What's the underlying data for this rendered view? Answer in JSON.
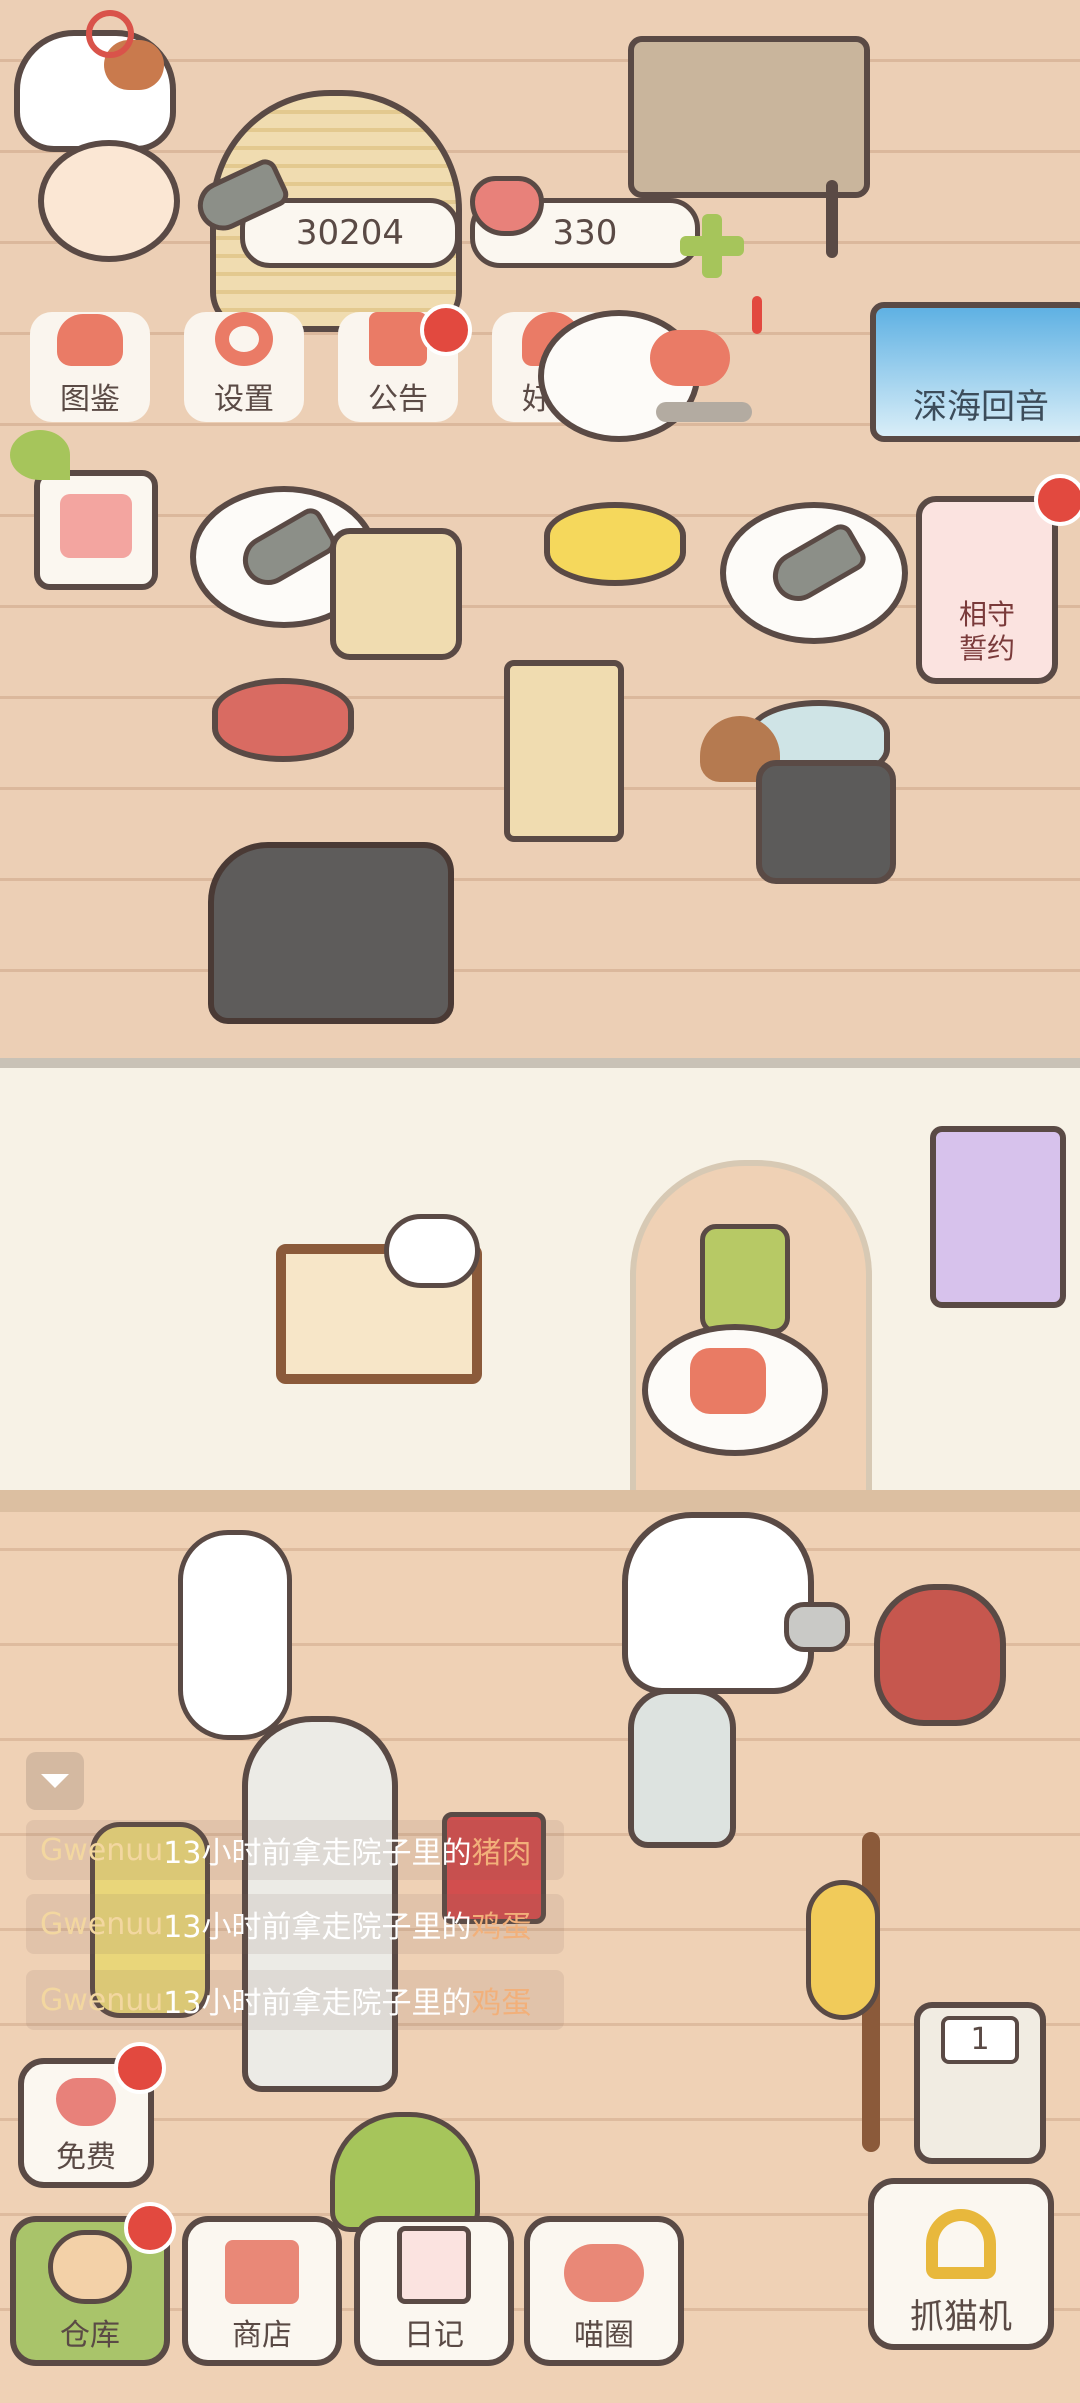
{
  "currency": {
    "fish": "30204",
    "hearts": "330"
  },
  "top_menu": [
    {
      "label": "图鉴",
      "icon": "cat-book-icon"
    },
    {
      "label": "设置",
      "icon": "gear-icon"
    },
    {
      "label": "公告",
      "icon": "gift-icon"
    },
    {
      "label": "好友",
      "icon": "friends-icon"
    }
  ],
  "events": {
    "deep_sea": "深海回音",
    "promise": "相守\n誓约"
  },
  "activity_log": [
    {
      "name": "Gwenuu",
      "text": "13小时前拿走院子里的",
      "item": "猪肉"
    },
    {
      "name": "Gwenuu",
      "text": "13小时前拿走院子里的",
      "item": "鸡蛋"
    },
    {
      "name": "Gwenuu",
      "text": "13小时前拿走院子里的",
      "item": "鸡蛋"
    }
  ],
  "free_label": "免费",
  "bottom_nav": [
    {
      "label": "仓库",
      "icon": "storage-icon"
    },
    {
      "label": "商店",
      "icon": "shop-icon"
    },
    {
      "label": "日记",
      "icon": "diary-icon"
    },
    {
      "label": "喵圈",
      "icon": "cat-planet-icon"
    }
  ],
  "claw_machine": {
    "label": "抓猫机",
    "count": "1"
  },
  "colors": {
    "accent_red": "#e2493f",
    "outline": "#5a4a45",
    "floor": "#eccfb5",
    "wall": "#f7f2e6"
  }
}
